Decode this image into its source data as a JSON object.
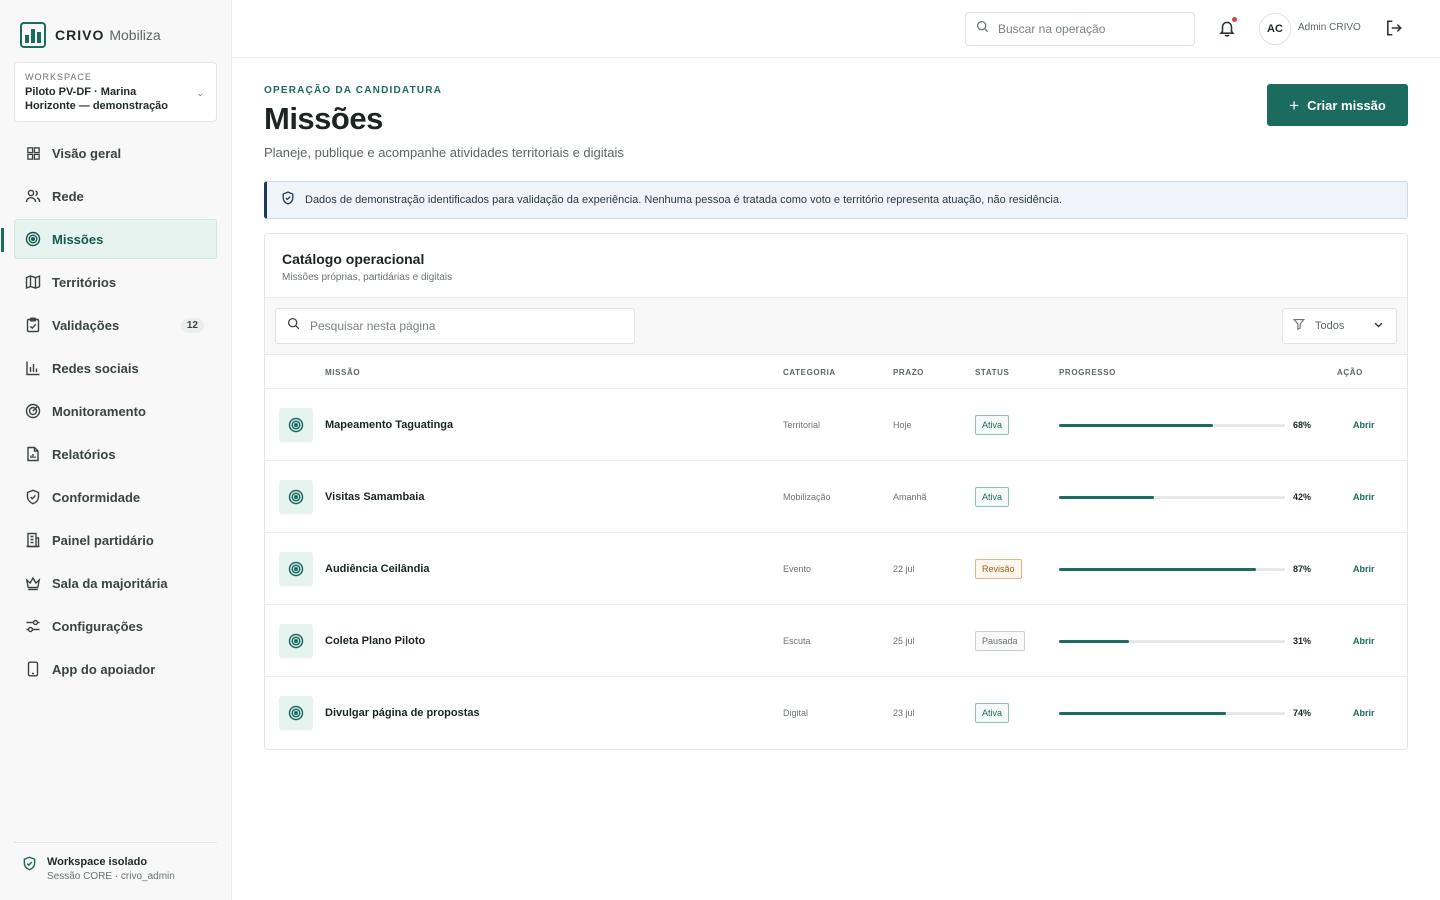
{
  "brand": {
    "name": "CRIVO",
    "product": "Mobiliza"
  },
  "workspace": {
    "label": "WORKSPACE",
    "name": "Piloto PV-DF · Marina Horizonte — demonstração"
  },
  "nav": [
    {
      "label": "Visão geral",
      "icon": "grid-icon",
      "active": false
    },
    {
      "label": "Rede",
      "icon": "users-icon",
      "active": false
    },
    {
      "label": "Missões",
      "icon": "target-icon",
      "active": true
    },
    {
      "label": "Territórios",
      "icon": "map-icon",
      "active": false
    },
    {
      "label": "Validações",
      "icon": "clipboard-check-icon",
      "active": false,
      "badge": "12"
    },
    {
      "label": "Redes sociais",
      "icon": "bar-chart-icon",
      "active": false
    },
    {
      "label": "Monitoramento",
      "icon": "radar-icon",
      "active": false
    },
    {
      "label": "Relatórios",
      "icon": "report-icon",
      "active": false
    },
    {
      "label": "Conformidade",
      "icon": "shield-check-icon",
      "active": false
    },
    {
      "label": "Painel partidário",
      "icon": "building-icon",
      "active": false
    },
    {
      "label": "Sala da majoritária",
      "icon": "crown-icon",
      "active": false
    },
    {
      "label": "Configurações",
      "icon": "sliders-icon",
      "active": false
    },
    {
      "label": "App do apoiador",
      "icon": "phone-icon",
      "active": false
    }
  ],
  "sidebar_footer": {
    "title": "Workspace isolado",
    "subtitle": "Sessão CORE · crivo_admin"
  },
  "header": {
    "search_placeholder": "Buscar na operação",
    "user_initials": "AC",
    "user_name": "Admin CRIVO"
  },
  "page": {
    "eyebrow": "OPERAÇÃO DA CANDIDATURA",
    "title": "Missões",
    "subtitle": "Planeje, publique e acompanhe atividades territoriais e digitais",
    "create_label": "Criar missão",
    "notice": "Dados de demonstração identificados para validação da experiência. Nenhuma pessoa é tratada como voto e território representa atuação, não residência."
  },
  "catalog": {
    "title": "Catálogo operacional",
    "subtitle": "Missões próprias, partidárias e digitais",
    "search_placeholder": "Pesquisar nesta página",
    "filter_value": "Todos",
    "columns": {
      "mission": "MISSÃO",
      "category": "CATEGORIA",
      "due": "PRAZO",
      "status": "STATUS",
      "progress": "PROGRESSO",
      "action": "AÇÃO"
    },
    "rows": [
      {
        "name": "Mapeamento Taguatinga",
        "category": "Territorial",
        "due": "Hoje",
        "status": "Ativa",
        "status_type": "ativa",
        "progress": 68,
        "progress_label": "68%",
        "action": "Abrir"
      },
      {
        "name": "Visitas Samambaia",
        "category": "Mobilização",
        "due": "Amanhã",
        "status": "Ativa",
        "status_type": "ativa",
        "progress": 42,
        "progress_label": "42%",
        "action": "Abrir"
      },
      {
        "name": "Audiência Ceilândia",
        "category": "Evento",
        "due": "22 jul",
        "status": "Revisão",
        "status_type": "revisao",
        "progress": 87,
        "progress_label": "87%",
        "action": "Abrir"
      },
      {
        "name": "Coleta Plano Piloto",
        "category": "Escuta",
        "due": "25 jul",
        "status": "Pausada",
        "status_type": "pausada",
        "progress": 31,
        "progress_label": "31%",
        "action": "Abrir"
      },
      {
        "name": "Divulgar página de propostas",
        "category": "Digital",
        "due": "23 jul",
        "status": "Ativa",
        "status_type": "ativa",
        "progress": 74,
        "progress_label": "74%",
        "action": "Abrir"
      }
    ]
  },
  "colors": {
    "accent": "#1b6b5e",
    "accent_light": "#e6f3ef",
    "notice_border": "#1f3b5c"
  }
}
